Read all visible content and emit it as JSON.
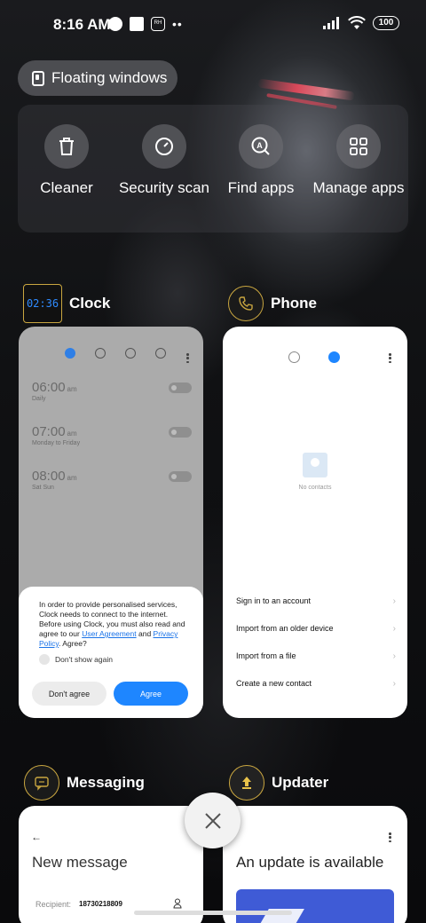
{
  "status_bar": {
    "time": "8:16 AM",
    "battery": "100"
  },
  "floating_windows": {
    "label": "Floating windows"
  },
  "tools": [
    {
      "label": "Cleaner",
      "icon": "trash-icon"
    },
    {
      "label": "Security scan",
      "icon": "speedometer-icon"
    },
    {
      "label": "Find apps",
      "icon": "find-apps-icon"
    },
    {
      "label": "Manage apps",
      "icon": "grid-icon"
    }
  ],
  "apps": {
    "clock": {
      "name": "Clock",
      "thumb_time": "02:36",
      "alarms": [
        {
          "time": "06:00",
          "ampm": "am",
          "repeat": "Daily"
        },
        {
          "time": "07:00",
          "ampm": "am",
          "repeat": "Monday to Friday"
        },
        {
          "time": "08:00",
          "ampm": "am",
          "repeat": "Sat Sun"
        }
      ],
      "consent": {
        "text_before": "In order to provide personalised services, Clock needs to connect to the internet. Before using Clock, you must also read and agree to our ",
        "link1": "User Agreement",
        "and": " and ",
        "link2": "Privacy Policy",
        "text_after": ". Agree?",
        "checkbox_label": "Don't show again",
        "decline": "Don't agree",
        "accept": "Agree"
      }
    },
    "phone": {
      "name": "Phone",
      "empty_label": "No contacts",
      "options": [
        "Sign in to an account",
        "Import from an older device",
        "Import from a file",
        "Create a new contact"
      ]
    },
    "messaging": {
      "name": "Messaging",
      "title": "New message",
      "recipient_label": "Recipient:",
      "recipient_value": "18730218809"
    },
    "updater": {
      "name": "Updater",
      "title": "An update is available"
    }
  },
  "colors": {
    "accent_blue": "#1e86ff",
    "gold_ring": "#c9a640"
  }
}
